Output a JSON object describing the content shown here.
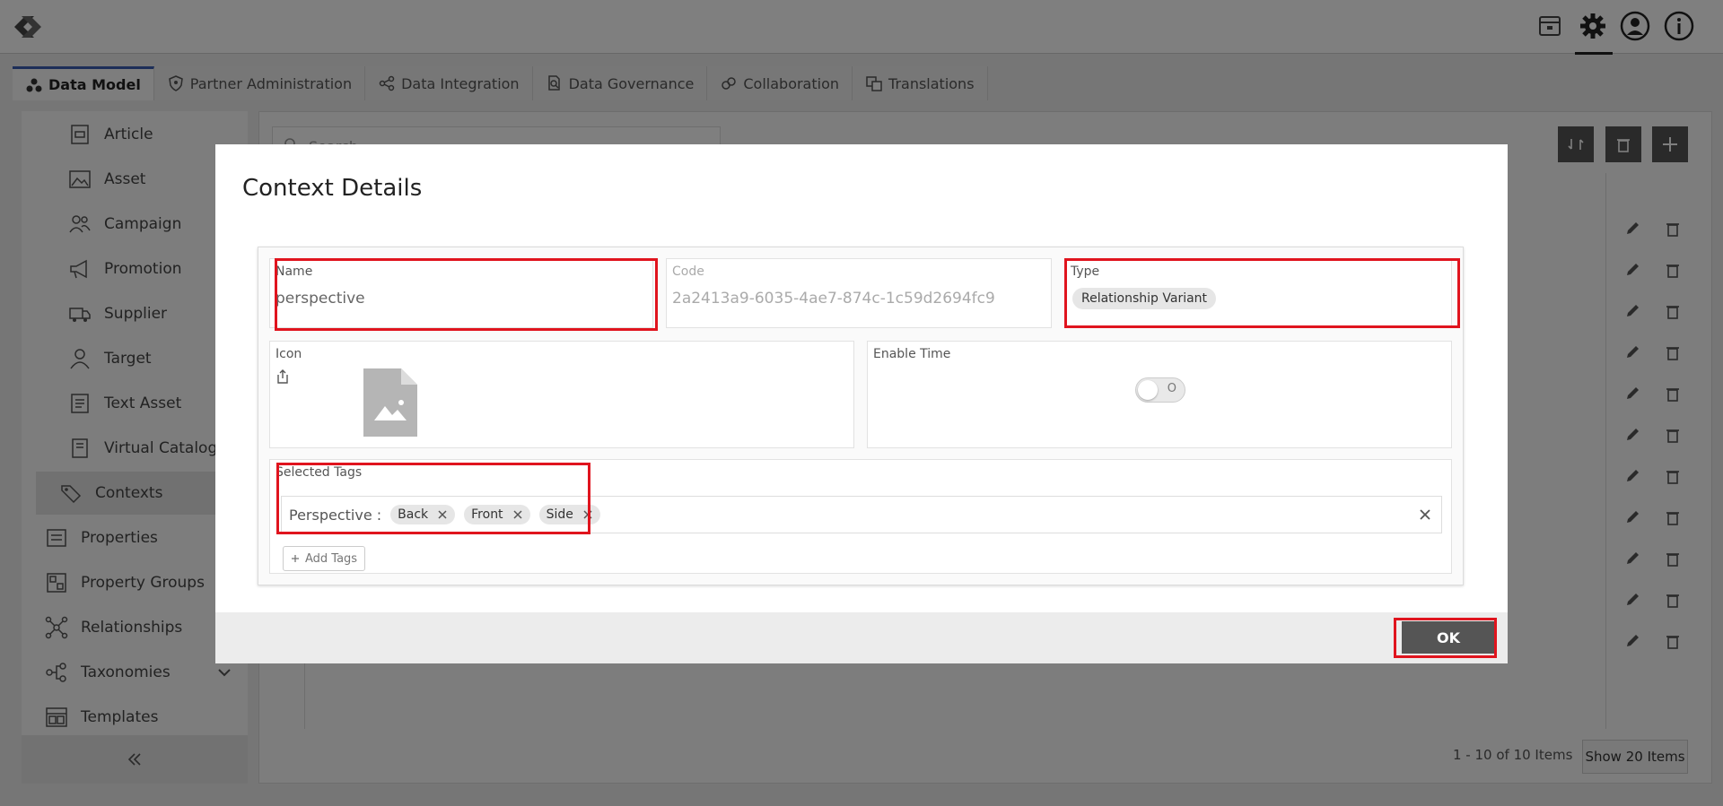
{
  "tabs": [
    {
      "label": "Data Model",
      "icon": "data-model-icon"
    },
    {
      "label": "Partner Administration",
      "icon": "shield-icon"
    },
    {
      "label": "Data Integration",
      "icon": "share-nodes-icon"
    },
    {
      "label": "Data Governance",
      "icon": "document-search-icon"
    },
    {
      "label": "Collaboration",
      "icon": "link-icon"
    },
    {
      "label": "Translations",
      "icon": "translate-icon"
    }
  ],
  "sidebar": {
    "items": [
      {
        "label": "Article",
        "icon": "article-icon"
      },
      {
        "label": "Asset",
        "icon": "image-icon"
      },
      {
        "label": "Campaign",
        "icon": "people-icon"
      },
      {
        "label": "Promotion",
        "icon": "megaphone-icon"
      },
      {
        "label": "Supplier",
        "icon": "truck-icon"
      },
      {
        "label": "Target",
        "icon": "user-icon"
      },
      {
        "label": "Text Asset",
        "icon": "text-document-icon"
      },
      {
        "label": "Virtual Catalog",
        "icon": "catalog-icon"
      },
      {
        "label": "Contexts",
        "icon": "tag-icon"
      },
      {
        "label": "Properties",
        "icon": "list-icon"
      },
      {
        "label": "Property Groups",
        "icon": "property-groups-icon"
      },
      {
        "label": "Relationships",
        "icon": "network-icon"
      },
      {
        "label": "Taxonomies",
        "icon": "taxonomy-icon"
      },
      {
        "label": "Templates",
        "icon": "template-icon"
      }
    ]
  },
  "main": {
    "search_placeholder": "Search",
    "pager_text": "1 - 10 of 10 Items",
    "show_items_label": "Show 20 Items"
  },
  "modal": {
    "title": "Context Details",
    "name_label": "Name",
    "name_value": "perspective",
    "code_label": "Code",
    "code_value": "2a2413a9-6035-4ae7-874c-1c59d2694fc9",
    "type_label": "Type",
    "type_value": "Relationship Variant",
    "icon_label": "Icon",
    "enable_time_label": "Enable Time",
    "toggle_text": "O",
    "selected_tags_label": "Selected Tags",
    "tags_prefix": "Perspective :",
    "tags": [
      "Back",
      "Front",
      "Side"
    ],
    "add_tags_label": "Add Tags",
    "ok_label": "OK"
  },
  "colors": {
    "highlight": "#e0141e",
    "active_tab": "#3a5cb0",
    "button_dark": "#555555"
  }
}
